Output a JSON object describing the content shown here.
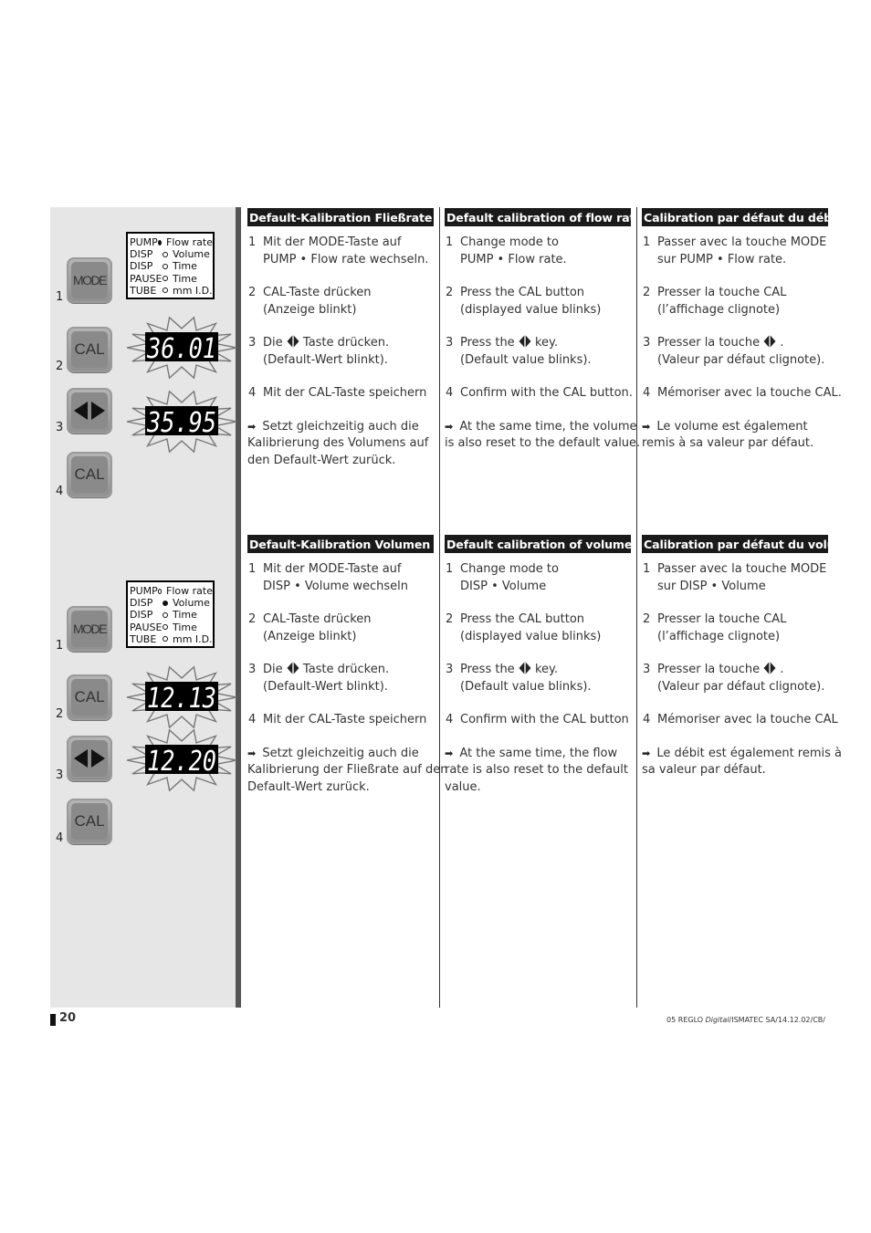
{
  "page_number": "20",
  "footer": {
    "ref_prefix": "05 REGLO ",
    "ref_italic": "Digital",
    "ref_suffix": "/ISMATEC SA/14.12.02/CB/"
  },
  "figures": [
    {
      "mode_list": [
        {
          "mode": "PUMP",
          "label": "Flow rate",
          "selected": true
        },
        {
          "mode": "DISP",
          "label": "Volume",
          "selected": false
        },
        {
          "mode": "DISP",
          "label": "Time",
          "selected": false
        },
        {
          "mode": "PAUSE",
          "label": "Time",
          "selected": false
        },
        {
          "mode": "TUBE",
          "label": "mm I.D.",
          "selected": false
        }
      ],
      "keys": [
        {
          "step": "1",
          "label": "MODE"
        },
        {
          "step": "2",
          "label": "CAL"
        },
        {
          "step": "3",
          "label": "arrows"
        },
        {
          "step": "4",
          "label": "CAL"
        }
      ],
      "displays": [
        "36.01",
        "35.95"
      ]
    },
    {
      "mode_list": [
        {
          "mode": "PUMP",
          "label": "Flow rate",
          "selected": false
        },
        {
          "mode": "DISP",
          "label": "Volume",
          "selected": true
        },
        {
          "mode": "DISP",
          "label": "Time",
          "selected": false
        },
        {
          "mode": "PAUSE",
          "label": "Time",
          "selected": false
        },
        {
          "mode": "TUBE",
          "label": "mm I.D.",
          "selected": false
        }
      ],
      "keys": [
        {
          "step": "1",
          "label": "MODE"
        },
        {
          "step": "2",
          "label": "CAL"
        },
        {
          "step": "3",
          "label": "arrows"
        },
        {
          "step": "4",
          "label": "CAL"
        }
      ],
      "displays": [
        "12.13",
        "12.20"
      ]
    }
  ],
  "sections": {
    "de_flow": {
      "title": "Default-Kalibration Fließrate",
      "s1": [
        "Mit der MODE-Taste auf",
        "PUMP • Flow rate wechseln."
      ],
      "s2": [
        "CAL-Taste drücken",
        "(Anzeige blinkt)"
      ],
      "s3a": "Die",
      "s3b": "Taste drücken.",
      "s3c": "(Default-Wert blinkt).",
      "s4": "Mit der CAL-Taste speichern",
      "note": [
        "Setzt gleichzeitig auch die",
        "Kalibrierung des Volumens auf",
        "den Default-Wert zurück."
      ]
    },
    "en_flow": {
      "title": "Default calibration of flow rate",
      "s1": [
        "Change mode to",
        "PUMP • Flow rate."
      ],
      "s2": [
        "Press the CAL button",
        "(displayed value blinks)"
      ],
      "s3a": "Press the",
      "s3b": "key.",
      "s3c": "(Default value blinks).",
      "s4": "Confirm with the CAL button.",
      "note": [
        "At the same time, the volume",
        "is also reset to the default value."
      ]
    },
    "fr_flow": {
      "title": "Calibration par défaut du débit",
      "s1": [
        "Passer avec la touche MODE",
        "sur PUMP • Flow rate."
      ],
      "s2": [
        "Presser la touche CAL",
        "(l’affichage clignote)"
      ],
      "s3a": "Presser la touche",
      "s3b": ".",
      "s3c": "(Valeur par défaut clignote).",
      "s4": "Mémoriser avec la touche CAL.",
      "note": [
        "Le volume est également",
        "remis à sa valeur par défaut."
      ]
    },
    "de_vol": {
      "title": "Default-Kalibration Volumen",
      "s1": [
        "Mit der MODE-Taste auf",
        "DISP • Volume wechseln"
      ],
      "s2": [
        "CAL-Taste drücken",
        "(Anzeige blinkt)"
      ],
      "s3a": "Die",
      "s3b": "Taste drücken.",
      "s3c": "(Default-Wert blinkt).",
      "s4": "Mit der CAL-Taste speichern",
      "note": [
        "Setzt gleichzeitig auch die",
        "Kalibrierung der Fließrate auf den",
        "Default-Wert zurück."
      ]
    },
    "en_vol": {
      "title": "Default calibration of volume",
      "s1": [
        "Change mode to",
        "DISP • Volume"
      ],
      "s2": [
        "Press the CAL button",
        "(displayed value blinks)"
      ],
      "s3a": "Press the",
      "s3b": "key.",
      "s3c": "(Default value blinks).",
      "s4": "Confirm with the CAL button",
      "note": [
        "At the same time, the flow",
        "rate is also reset to the default",
        "value."
      ]
    },
    "fr_vol": {
      "title": "Calibration par défaut du volume",
      "s1": [
        "Passer avec la touche MODE",
        "sur DISP • Volume"
      ],
      "s2": [
        "Presser la touche CAL",
        "(l’affichage clignote)"
      ],
      "s3a": "Presser la touche",
      "s3b": ".",
      "s3c": "(Valeur par défaut clignote).",
      "s4": "Mémoriser avec la touche CAL",
      "note": [
        "Le débit est également remis à",
        "sa valeur par défaut."
      ]
    }
  }
}
